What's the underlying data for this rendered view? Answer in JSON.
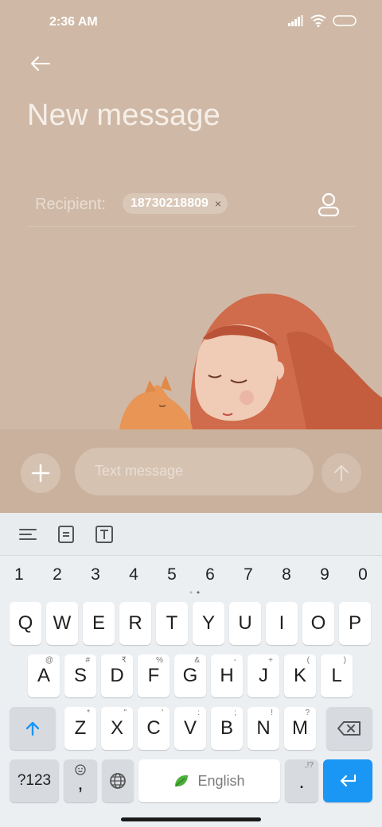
{
  "status_bar": {
    "time": "2:36 AM"
  },
  "header": {
    "title": "New message"
  },
  "recipient": {
    "label": "Recipient:",
    "chip": "18730218809",
    "chip_remove": "×"
  },
  "composer": {
    "placeholder": "Text message"
  },
  "keyboard": {
    "numbers": [
      "1",
      "2",
      "3",
      "4",
      "5",
      "6",
      "7",
      "8",
      "9",
      "0"
    ],
    "row1": [
      "Q",
      "W",
      "E",
      "R",
      "T",
      "Y",
      "U",
      "I",
      "O",
      "P"
    ],
    "row2": [
      {
        "k": "A",
        "h": "@"
      },
      {
        "k": "S",
        "h": "#"
      },
      {
        "k": "D",
        "h": "₹"
      },
      {
        "k": "F",
        "h": "%"
      },
      {
        "k": "G",
        "h": "&"
      },
      {
        "k": "H",
        "h": "-"
      },
      {
        "k": "J",
        "h": "+"
      },
      {
        "k": "K",
        "h": "("
      },
      {
        "k": "L",
        "h": ")"
      }
    ],
    "row3": [
      {
        "k": "Z",
        "h": "*"
      },
      {
        "k": "X",
        "h": "\""
      },
      {
        "k": "C",
        "h": "'"
      },
      {
        "k": "V",
        "h": ":"
      },
      {
        "k": "B",
        "h": ";"
      },
      {
        "k": "N",
        "h": "!"
      },
      {
        "k": "M",
        "h": "?"
      }
    ],
    "symbols_key": "?123",
    "comma_key": ",",
    "space_label": "English",
    "period_key": ".",
    "period_hint": ",!?"
  },
  "colors": {
    "accent": "#1a96f5",
    "app_bg": "#cfb9a6"
  }
}
